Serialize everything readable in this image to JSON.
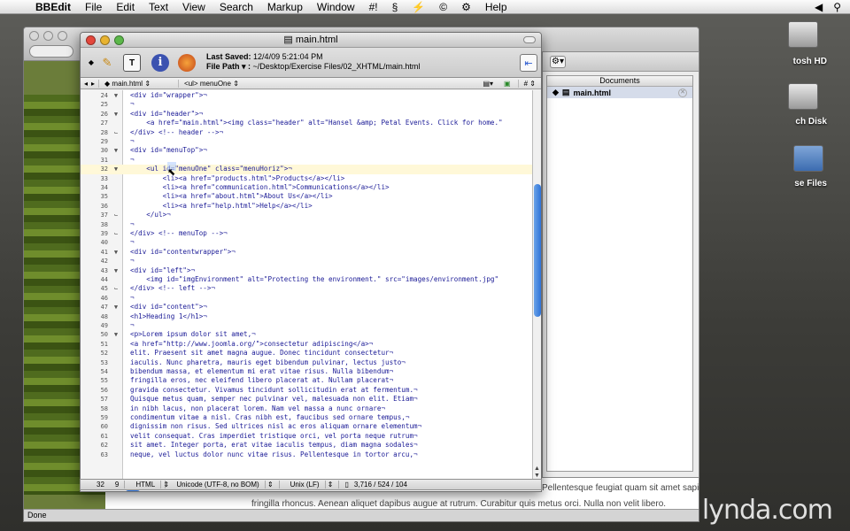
{
  "menubar": {
    "app": "BBEdit",
    "items": [
      "File",
      "Edit",
      "Text",
      "View",
      "Search",
      "Markup",
      "Window",
      "#!"
    ],
    "help": "Help"
  },
  "desktop": {
    "icons": [
      {
        "label": "tosh HD"
      },
      {
        "label": "ch Disk"
      },
      {
        "label": "se Files"
      }
    ]
  },
  "browser": {
    "page_text_line1": "fringilla rhoncus. Aenean aliquet dapibus augue at rutrum. Curabitur quis metus orci. Nulla non velit libero.",
    "page_text_partial": "Pellentesque feugiat quam sit amet sapien",
    "status": "Done"
  },
  "documents_panel": {
    "header": "Documents",
    "items": [
      {
        "label": "main.html"
      }
    ]
  },
  "editor": {
    "title": "main.html",
    "last_saved_label": "Last Saved:",
    "last_saved_value": "12/4/09 5:21:04 PM",
    "file_path_label": "File Path ▾ :",
    "file_path_value": "~/Desktop/Exercise Files/02_XHTML/main.html",
    "nav_file": "main.html",
    "nav_scope": "<ul> menuOne",
    "nav_hash": "#",
    "lines": [
      {
        "n": "24",
        "fold": "▼",
        "text": "<div id=\"wrapper\">¬"
      },
      {
        "n": "25",
        "fold": "",
        "text": "¬"
      },
      {
        "n": "26",
        "fold": "▼",
        "text": "<div id=\"header\">¬"
      },
      {
        "n": "27",
        "fold": "",
        "text": "    <a href=\"main.html\"><img class=\"header\" alt=\"Hansel &amp; Petal Events. Click for home.\""
      },
      {
        "n": "28",
        "fold": "⌙",
        "text": "</div> <!-- header -->¬"
      },
      {
        "n": "29",
        "fold": "",
        "text": "¬"
      },
      {
        "n": "30",
        "fold": "▼",
        "text": "<div id=\"menuTop\">¬"
      },
      {
        "n": "31",
        "fold": "",
        "text": "¬"
      },
      {
        "n": "32",
        "fold": "▼",
        "text": "    <ul id=\"menuOne\" class=\"menuHoriz\">¬"
      },
      {
        "n": "33",
        "fold": "",
        "text": "        <li><a href=\"products.html\">Products</a></li>"
      },
      {
        "n": "34",
        "fold": "",
        "text": "        <li><a href=\"communication.html\">Communications</a></li>"
      },
      {
        "n": "35",
        "fold": "",
        "text": "        <li><a href=\"about.html\">About Us</a></li>"
      },
      {
        "n": "36",
        "fold": "",
        "text": "        <li><a href=\"help.html\">Help</a></li>"
      },
      {
        "n": "37",
        "fold": "⌙",
        "text": "    </ul>¬"
      },
      {
        "n": "38",
        "fold": "",
        "text": "¬"
      },
      {
        "n": "39",
        "fold": "⌙",
        "text": "</div> <!-- menuTop -->¬"
      },
      {
        "n": "40",
        "fold": "",
        "text": "¬"
      },
      {
        "n": "41",
        "fold": "▼",
        "text": "<div id=\"contentwrapper\">¬"
      },
      {
        "n": "42",
        "fold": "",
        "text": "¬"
      },
      {
        "n": "43",
        "fold": "▼",
        "text": "<div id=\"left\">¬"
      },
      {
        "n": "44",
        "fold": "",
        "text": "    <img id=\"imgEnvironment\" alt=\"Protecting the environment.\" src=\"images/environment.jpg\""
      },
      {
        "n": "45",
        "fold": "⌙",
        "text": "</div> <!-- left -->¬"
      },
      {
        "n": "46",
        "fold": "",
        "text": "¬"
      },
      {
        "n": "47",
        "fold": "▼",
        "text": "<div id=\"content\">¬"
      },
      {
        "n": "48",
        "fold": "",
        "text": "<h1>Heading 1</h1>¬"
      },
      {
        "n": "49",
        "fold": "",
        "text": "¬"
      },
      {
        "n": "50",
        "fold": "▼",
        "text": "<p>Lorem ipsum dolor sit amet,¬"
      },
      {
        "n": "51",
        "fold": "",
        "text": "<a href=\"http://www.joomla.org/\">consectetur adipiscing</a>¬"
      },
      {
        "n": "52",
        "fold": "",
        "text": "elit. Praesent sit amet magna augue. Donec tincidunt consectetur¬"
      },
      {
        "n": "53",
        "fold": "",
        "text": "iaculis. Nunc pharetra, mauris eget bibendum pulvinar, lectus justo¬"
      },
      {
        "n": "54",
        "fold": "",
        "text": "bibendum massa, et elementum mi erat vitae risus. Nulla bibendum¬"
      },
      {
        "n": "55",
        "fold": "",
        "text": "fringilla eros, nec eleifend libero placerat at. Nullam placerat¬"
      },
      {
        "n": "56",
        "fold": "",
        "text": "gravida consectetur. Vivamus tincidunt sollicitudin erat at fermentum.¬"
      },
      {
        "n": "57",
        "fold": "",
        "text": "Quisque metus quam, semper nec pulvinar vel, malesuada non elit. Etiam¬"
      },
      {
        "n": "58",
        "fold": "",
        "text": "in nibh lacus, non placerat lorem. Nam vel massa a nunc ornare¬"
      },
      {
        "n": "59",
        "fold": "",
        "text": "condimentum vitae a nisl. Cras nibh est, faucibus sed ornare tempus,¬"
      },
      {
        "n": "60",
        "fold": "",
        "text": "dignissim non risus. Sed ultrices nisl ac eros aliquam ornare elementum¬"
      },
      {
        "n": "61",
        "fold": "",
        "text": "velit consequat. Cras imperdiet tristique orci, vel porta neque rutrum¬"
      },
      {
        "n": "62",
        "fold": "",
        "text": "sit amet. Integer porta, erat vitae iaculis tempus, diam magna sodales¬"
      },
      {
        "n": "63",
        "fold": "",
        "text": "neque, vel luctus dolor nunc vitae risus. Pellentesque in tortor arcu,¬"
      }
    ],
    "status": {
      "line": "32",
      "col": "9",
      "language": "HTML",
      "encoding": "Unicode (UTF-8, no BOM)",
      "line_endings": "Unix (LF)",
      "counts": "3,716 / 524 / 104"
    }
  },
  "watermark": "lynda.com"
}
